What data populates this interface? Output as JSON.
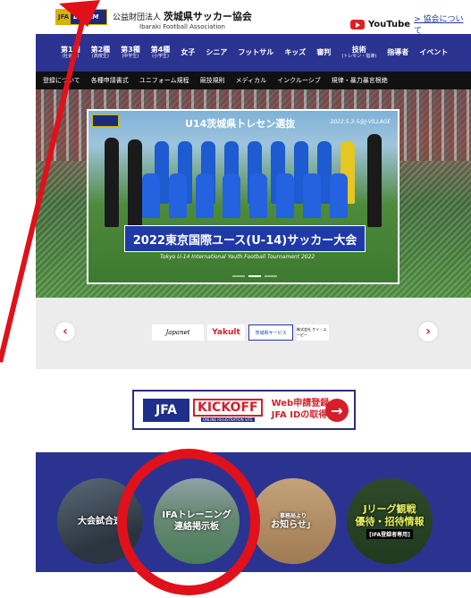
{
  "header": {
    "logo_jfa": "JFA",
    "logo_dream": "DREAM",
    "assoc_prefix": "公益財団法人",
    "assoc_name": "茨城県サッカー協会",
    "assoc_en": "Ibaraki Football Association",
    "youtube_label": "YouTube",
    "about_link": "> 協会について"
  },
  "main_nav": [
    {
      "label": "第1種",
      "sub": "(社会人)"
    },
    {
      "label": "第2種",
      "sub": "(高校生)"
    },
    {
      "label": "第3種",
      "sub": "(中学生)"
    },
    {
      "label": "第4種",
      "sub": "(小学生)"
    },
    {
      "label": "女子",
      "sub": ""
    },
    {
      "label": "シニア",
      "sub": ""
    },
    {
      "label": "フットサル",
      "sub": ""
    },
    {
      "label": "キッズ",
      "sub": ""
    },
    {
      "label": "審判",
      "sub": ""
    },
    {
      "label": "技術",
      "sub": "(トレセン・指導)"
    },
    {
      "label": "指導者",
      "sub": ""
    },
    {
      "label": "イベント",
      "sub": ""
    }
  ],
  "sub_nav": [
    "登録について",
    "各種申請書式",
    "ユニフォーム規程",
    "競技規則",
    "メディカル",
    "インクルーシブ",
    "規律・暴力暴言根絶"
  ],
  "hero": {
    "title": "U14茨城県トレセン選抜",
    "date": "2022.5.3-5@J-VILLAGE",
    "banner": "2022東京国際ユース(U-14)サッカー大会",
    "banner_en": "Tokyo U-14 International Youth Football Tournament 2022"
  },
  "sponsors": {
    "prev": "‹",
    "next": "›",
    "logos": [
      "Japanet",
      "Yakult",
      "茨城県サービス",
      "株式会社 ケイ・ユーピー"
    ]
  },
  "kickoff": {
    "jfa": "JFA",
    "kickoff": "KICKOFF",
    "kickoff_sub": "ONLINE REGISTRATION SITE",
    "line1": "Web申請登録",
    "line2": "JFA IDの取得",
    "arrow": "→"
  },
  "bottom_links": {
    "c1": "大会試合速",
    "c2": "IFAトレーニング\n連絡掲示板",
    "c3_small": "事務局より",
    "c3": "お知らせ」",
    "c4": "Jリーグ観戦\n優待・招待情報",
    "c4_note": "[IFA登録者専用]"
  },
  "colors": {
    "nav_blue": "#2b3391",
    "accent_red": "#e0111a",
    "gold": "#d8b200"
  }
}
